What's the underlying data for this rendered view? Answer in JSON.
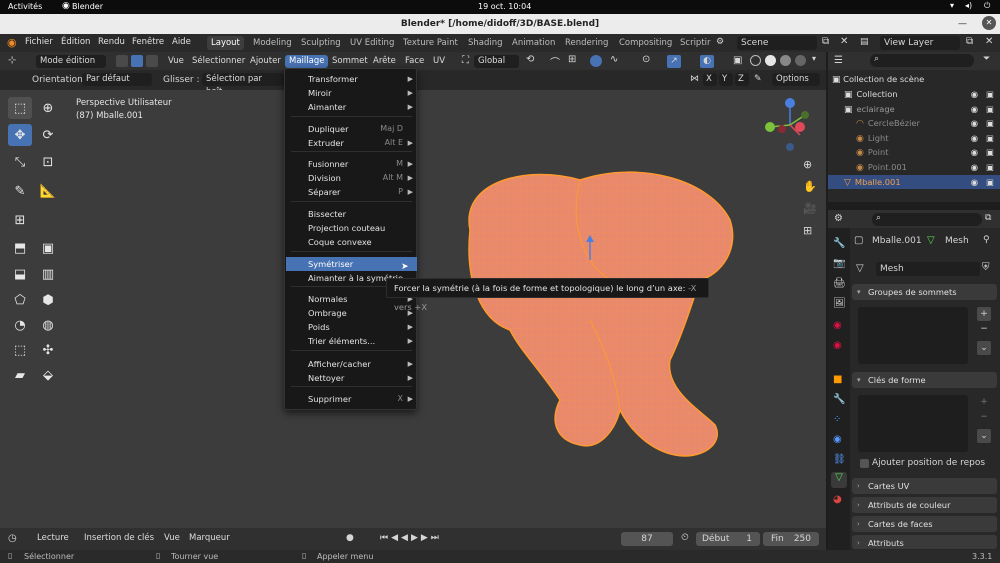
{
  "gnome": {
    "activities": "Activités",
    "app": "Blender",
    "clock": "19 oct.  10:04"
  },
  "window": {
    "title": "Blender* [/home/didoff/3D/BASE.blend]"
  },
  "menubar": {
    "items": [
      "Fichier",
      "Édition",
      "Rendu",
      "Fenêtre",
      "Aide"
    ],
    "tabs": [
      "Layout",
      "Modeling",
      "Sculpting",
      "UV Editing",
      "Texture Paint",
      "Shading",
      "Animation",
      "Rendering",
      "Compositing",
      "Scriptir"
    ],
    "scene": "Scene",
    "view_layer": "View Layer"
  },
  "header": {
    "mode": "Mode édition",
    "menus": [
      "Vue",
      "Sélectionner",
      "Ajouter",
      "Maillage",
      "Sommet",
      "Arête",
      "Face",
      "UV"
    ],
    "transform_orientation": "Global",
    "options": "Options",
    "x": "X",
    "y": "Y",
    "z": "Z"
  },
  "header2": {
    "orientation_label": "Orientation:",
    "orientation_value": "Par défaut",
    "drag_label": "Glisser :",
    "drag_value": "Sélection par boît"
  },
  "viewport": {
    "perspective": "Perspective Utilisateur",
    "object": "(87) Mballe.001"
  },
  "menu": {
    "items": [
      {
        "label": "Transformer",
        "shortcut": "",
        "arrow": true
      },
      {
        "label": "Miroir",
        "shortcut": "",
        "arrow": true
      },
      {
        "label": "Aimanter",
        "shortcut": "",
        "arrow": true
      },
      {
        "label": "Dupliquer",
        "shortcut": "Maj D",
        "arrow": false
      },
      {
        "label": "Extruder",
        "shortcut": "Alt E",
        "arrow": true
      },
      {
        "label": "Fusionner",
        "shortcut": "M",
        "arrow": true
      },
      {
        "label": "Division",
        "shortcut": "Alt M",
        "arrow": true
      },
      {
        "label": "Séparer",
        "shortcut": "P",
        "arrow": true
      },
      {
        "label": "Bissecter",
        "shortcut": "",
        "arrow": false
      },
      {
        "label": "Projection couteau",
        "shortcut": "",
        "arrow": false
      },
      {
        "label": "Coque convexe",
        "shortcut": "",
        "arrow": false
      },
      {
        "label": "Symétriser",
        "shortcut": "",
        "arrow": false
      },
      {
        "label": "Aimanter à la symétrie",
        "shortcut": "",
        "arrow": false
      },
      {
        "label": "Normales",
        "shortcut": "",
        "arrow": true
      },
      {
        "label": "Ombrage",
        "shortcut": "",
        "arrow": true
      },
      {
        "label": "Poids",
        "shortcut": "",
        "arrow": true
      },
      {
        "label": "Trier éléments...",
        "shortcut": "",
        "arrow": true
      },
      {
        "label": "Afficher/cacher",
        "shortcut": "",
        "arrow": true
      },
      {
        "label": "Nettoyer",
        "shortcut": "",
        "arrow": true
      },
      {
        "label": "Supprimer",
        "shortcut": "X",
        "arrow": true
      }
    ],
    "highlighted": "Symétriser"
  },
  "tooltip": {
    "text": "Forcer la symétrie (à la fois de forme et topologique) le long d’un axe:",
    "alt": "-X vers +X"
  },
  "timeline": {
    "playback": "Lecture",
    "keying": "Insertion de clés",
    "view": "Vue",
    "markers": "Marqueur",
    "current_frame": "87",
    "start_label": "Début",
    "start": "1",
    "end_label": "Fin",
    "end": "250"
  },
  "status": {
    "select": "Sélectionner",
    "rotate": "Tourner vue",
    "menu": "Appeler menu",
    "version": "3.3.1"
  },
  "outliner": {
    "root": "Collection de scène",
    "rows": [
      {
        "label": "Collection",
        "indent": 1
      },
      {
        "label": "eclairage",
        "indent": 1
      },
      {
        "label": "CercleBézier",
        "indent": 2
      },
      {
        "label": "Light",
        "indent": 2
      },
      {
        "label": "Point",
        "indent": 2
      },
      {
        "label": "Point.001",
        "indent": 2
      },
      {
        "label": "Mballe.001",
        "indent": 1
      }
    ]
  },
  "properties": {
    "object": "Mballe.001",
    "mesh": "Mesh",
    "mesh_field": "Mesh",
    "panels": [
      "Groupes de sommets",
      "Clés de forme",
      "Cartes UV",
      "Attributs de couleur",
      "Cartes de faces",
      "Attributs"
    ],
    "add_rest_position": "Ajouter position de repos"
  },
  "colors": {
    "accent": "#4772b3",
    "mesh": "#e8896e",
    "wire": "#ff9a2e"
  }
}
